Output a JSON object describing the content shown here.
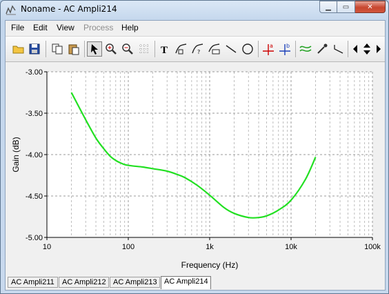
{
  "window": {
    "title": "Noname - AC Ampli214"
  },
  "caption_buttons": {
    "minimize": "▁",
    "maximize": "▭",
    "close": "✕"
  },
  "menu": [
    {
      "label": "File",
      "enabled": true
    },
    {
      "label": "Edit",
      "enabled": true
    },
    {
      "label": "View",
      "enabled": true
    },
    {
      "label": "Process",
      "enabled": false
    },
    {
      "label": "Help",
      "enabled": true
    }
  ],
  "toolbar": {
    "icons": [
      "open-folder-icon",
      "save-icon",
      "copy-icon",
      "paste-icon",
      "pointer-icon",
      "zoom-in-icon",
      "zoom-out-icon",
      "grid-icon",
      "text-tool-icon",
      "curve-label-icon",
      "curve-label-2-icon",
      "edit-label-icon",
      "line-tool-icon",
      "ellipse-tool-icon",
      "cursor-a-icon",
      "cursor-b-icon",
      "curves-icon",
      "eyedropper-icon",
      "marker-icon",
      "arrow-left-icon",
      "arrow-updown-icon",
      "arrow-right-icon"
    ]
  },
  "chart_data": {
    "type": "line",
    "xlabel": "Frequency (Hz)",
    "ylabel": "Gain (dB)",
    "xscale": "log",
    "xlim": [
      10,
      100000
    ],
    "ylim": [
      -5.0,
      -3.0
    ],
    "x_tick_labels": [
      "10",
      "100",
      "1k",
      "10k",
      "100k"
    ],
    "y_tick_labels": [
      "-3.00",
      "-3.50",
      "-4.00",
      "-4.50",
      "-5.00"
    ],
    "y_ticks": [
      -3.0,
      -3.5,
      -4.0,
      -4.5,
      -5.0
    ],
    "grid": true,
    "line_color": "#22e022",
    "series": [
      {
        "x": [
          20,
          30,
          40,
          50,
          60,
          70,
          80,
          90,
          100,
          120,
          150,
          200,
          300,
          400,
          500,
          700,
          1000,
          1500,
          2000,
          3000,
          4000,
          5000,
          7000,
          10000,
          15000,
          20000
        ],
        "y": [
          -3.25,
          -3.58,
          -3.8,
          -3.93,
          -4.02,
          -4.07,
          -4.1,
          -4.12,
          -4.13,
          -4.14,
          -4.15,
          -4.17,
          -4.2,
          -4.24,
          -4.28,
          -4.37,
          -4.49,
          -4.64,
          -4.71,
          -4.76,
          -4.76,
          -4.74,
          -4.67,
          -4.55,
          -4.3,
          -4.03
        ]
      }
    ]
  },
  "tabs": [
    {
      "label": "AC Ampli211",
      "active": false
    },
    {
      "label": "AC Ampli212",
      "active": false
    },
    {
      "label": "AC Ampli213",
      "active": false
    },
    {
      "label": "AC Ampli214",
      "active": true
    }
  ]
}
